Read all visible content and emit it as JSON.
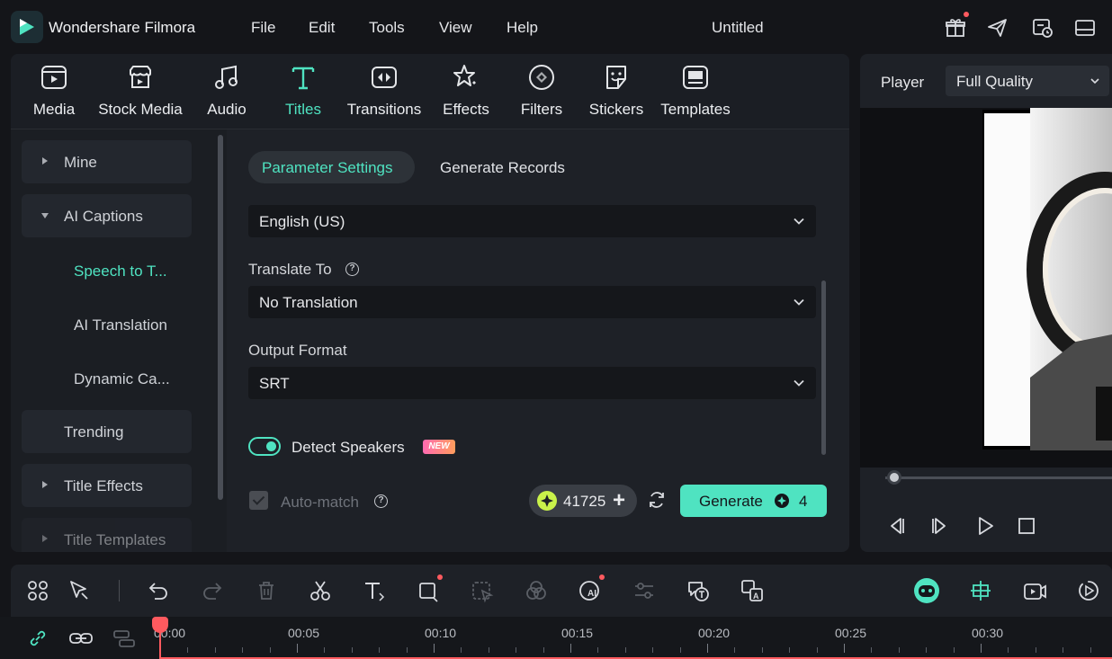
{
  "titlebar": {
    "app_name": "Wondershare Filmora",
    "menus": [
      "File",
      "Edit",
      "Tools",
      "View",
      "Help"
    ],
    "document_title": "Untitled"
  },
  "library": {
    "tabs": [
      {
        "label": "Media",
        "icon": "media-icon"
      },
      {
        "label": "Stock Media",
        "icon": "stock-media-icon"
      },
      {
        "label": "Audio",
        "icon": "audio-icon"
      },
      {
        "label": "Titles",
        "icon": "titles-icon",
        "active": true
      },
      {
        "label": "Transitions",
        "icon": "transitions-icon"
      },
      {
        "label": "Effects",
        "icon": "effects-icon"
      },
      {
        "label": "Filters",
        "icon": "filters-icon"
      },
      {
        "label": "Stickers",
        "icon": "stickers-icon"
      },
      {
        "label": "Templates",
        "icon": "templates-icon"
      }
    ],
    "sidebar": {
      "mine": "Mine",
      "ai_captions": "AI Captions",
      "speech_to_text": "Speech to T...",
      "ai_translation": "AI Translation",
      "dynamic_captions": "Dynamic Ca...",
      "trending": "Trending",
      "title_effects": "Title Effects",
      "title_templates": "Title Templates"
    },
    "content": {
      "tab_parameter": "Parameter Settings",
      "tab_records": "Generate Records",
      "language_value": "English (US)",
      "translate_label": "Translate To",
      "translate_value": "No Translation",
      "output_label": "Output Format",
      "output_value": "SRT",
      "detect_speakers": "Detect Speakers",
      "detect_speakers_on": true,
      "new_badge": "NEW",
      "auto_match": "Auto-match",
      "auto_match_checked": true,
      "credits": "41725",
      "generate_label": "Generate",
      "generate_cost": "4",
      "help_glyph": "?"
    }
  },
  "player": {
    "label": "Player",
    "quality": "Full Quality",
    "progress": 0.0
  },
  "timeline": {
    "ticks": [
      "00:00",
      "00:05",
      "00:10",
      "00:15",
      "00:20",
      "00:25",
      "00:30"
    ]
  },
  "colors": {
    "accent": "#4fe3c1",
    "record": "#ff5a5f",
    "background": "#141519",
    "panel": "#1e2127"
  }
}
